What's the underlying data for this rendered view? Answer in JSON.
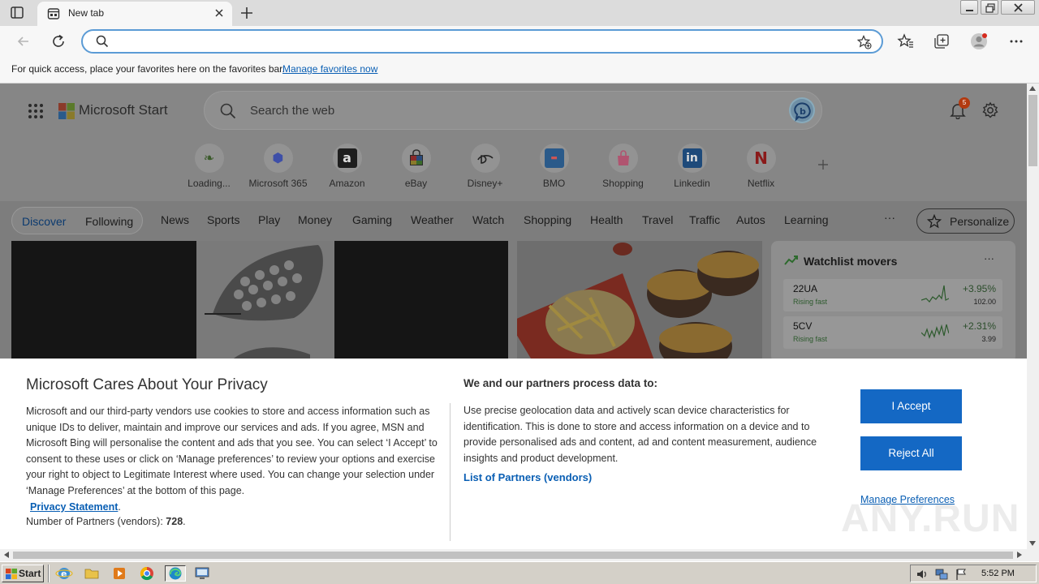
{
  "browser": {
    "tab_title": "New tab",
    "address_value": "",
    "favbar_text": "For quick access, place your favorites here on the favorites bar.",
    "favbar_link": "Manage favorites now"
  },
  "msn": {
    "brand": "Microsoft Start",
    "search_placeholder": "Search the web",
    "notification_count": "5",
    "quicklinks": [
      {
        "label": "Loading...",
        "icon": "loading-icon"
      },
      {
        "label": "Microsoft 365",
        "icon": "microsoft-365-icon"
      },
      {
        "label": "Amazon",
        "icon": "amazon-icon"
      },
      {
        "label": "eBay",
        "icon": "ebay-icon"
      },
      {
        "label": "Disney+",
        "icon": "disney-plus-icon"
      },
      {
        "label": "BMO",
        "icon": "bmo-icon"
      },
      {
        "label": "Shopping",
        "icon": "shopping-bag-icon"
      },
      {
        "label": "Linkedin",
        "icon": "linkedin-icon"
      },
      {
        "label": "Netflix",
        "icon": "netflix-icon"
      }
    ],
    "nav": {
      "discover": "Discover",
      "following": "Following",
      "items": [
        "News",
        "Sports",
        "Play",
        "Money",
        "Gaming",
        "Weather",
        "Watch",
        "Shopping",
        "Health",
        "Travel",
        "Traffic",
        "Autos",
        "Learning"
      ],
      "more": "···",
      "personalize": "Personalize"
    },
    "watchlist": {
      "title": "Watchlist movers",
      "more": "···",
      "rows": [
        {
          "symbol": "22UA",
          "status": "Rising fast",
          "change": "+3.95%",
          "price": "102.00"
        },
        {
          "symbol": "5CV",
          "status": "Rising fast",
          "change": "+2.31%",
          "price": "3.99"
        }
      ]
    }
  },
  "privacy": {
    "title": "Microsoft Cares About Your Privacy",
    "body": "Microsoft and our third-party vendors use cookies to store and access information such as unique IDs to deliver, maintain and improve our services and ads. If you agree, MSN and Microsoft Bing will personalise the content and ads that you see. You can select ‘I Accept’ to consent to these uses or click on ‘Manage preferences’ to review your options and exercise your right to object to Legitimate Interest where used.  You can change your selection under ‘Manage Preferences’ at the bottom of this page.",
    "privacy_link": "Privacy Statement",
    "privacy_link_suffix": ".",
    "partners_count_label": "Number of Partners (vendors): ",
    "partners_count": "728",
    "partners_count_suffix": ".",
    "subtitle": "We and our partners process data to:",
    "body2": "Use precise geolocation data and actively scan device characteristics for identification. This is done to store and access information on a device and to provide personalised ads and content, ad and content measurement, audience insights and product development.",
    "partners_link": "List of Partners (vendors)",
    "accept": "I Accept",
    "reject": "Reject All",
    "manage": "Manage Preferences"
  },
  "watermark": "ANY.RUN",
  "taskbar": {
    "start": "Start",
    "clock": "5:52 PM"
  },
  "colors": {
    "accent": "#1468c4",
    "link": "#0a5fb4",
    "address_focus": "#5b9bd5"
  }
}
